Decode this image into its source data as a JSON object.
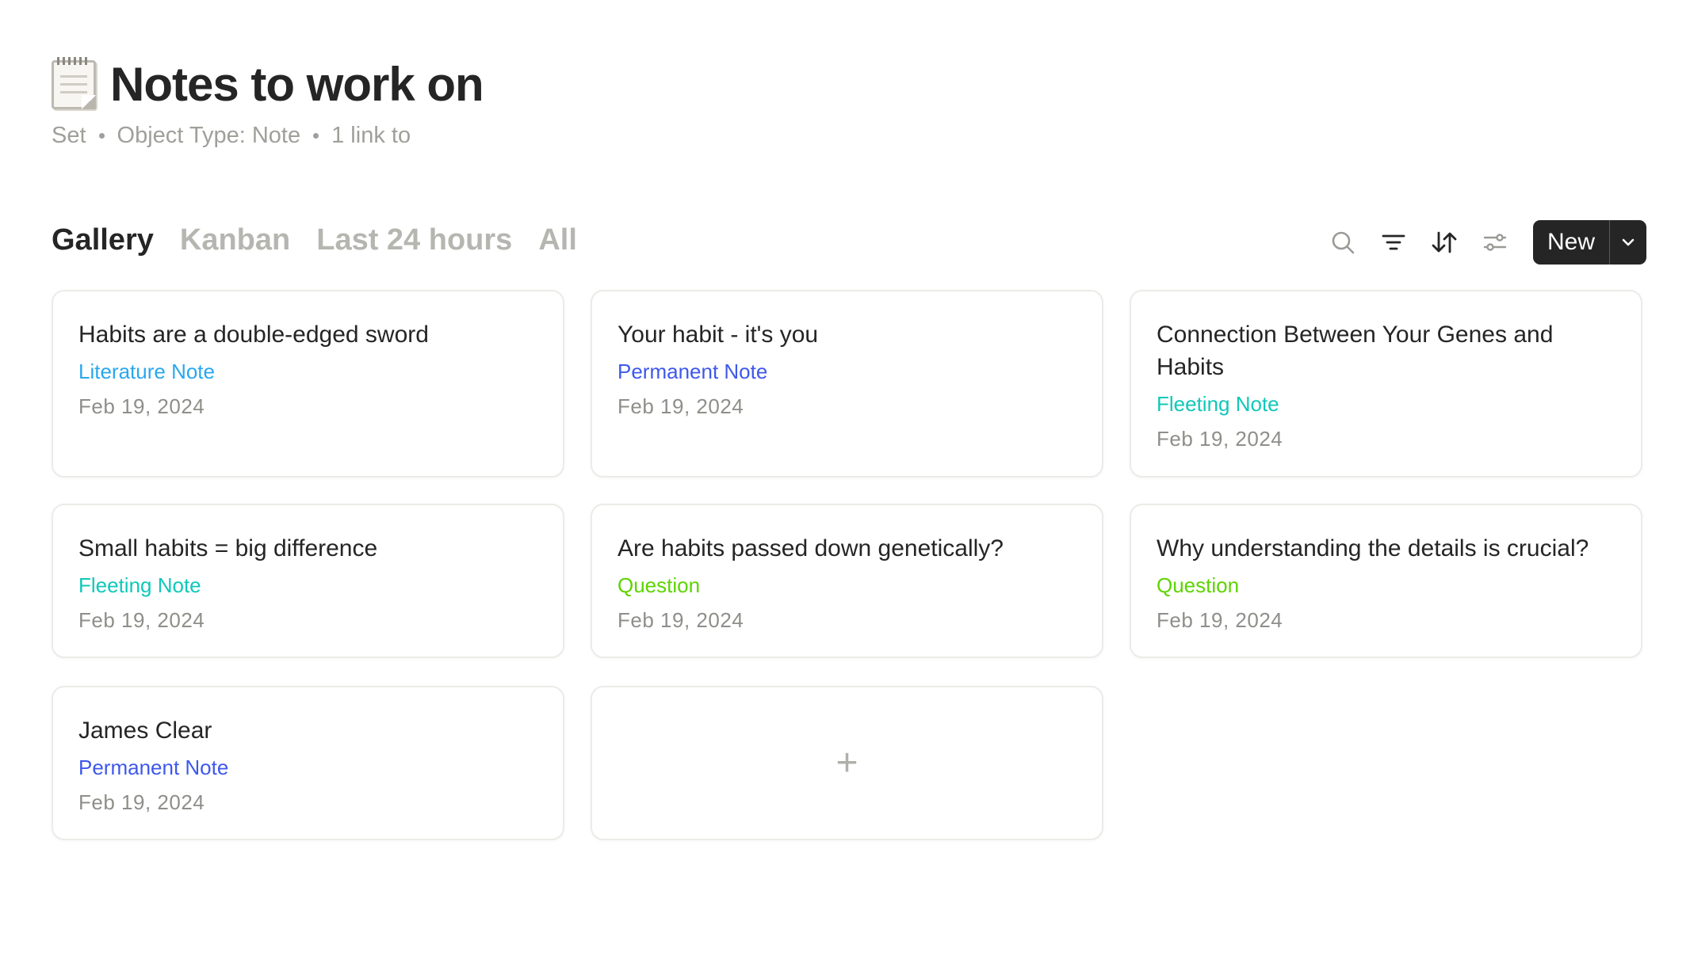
{
  "page": {
    "title": "Notes to work on",
    "meta": [
      "Set",
      "Object Type: Note",
      "1 link to"
    ]
  },
  "icons": {
    "title": "spiral-notepad-icon",
    "search": "search-icon",
    "filter": "filter-icon",
    "sort": "sort-icon",
    "settings": "view-settings-icon",
    "dropdown": "chevron-down-icon",
    "add": "plus-icon"
  },
  "views": [
    "Gallery",
    "Kanban",
    "Last 24 hours",
    "All"
  ],
  "toolbar": {
    "new_label": "New"
  },
  "type_colors": {
    "Literature Note": "#2aa7ee",
    "Permanent Note": "#3e58eb",
    "Fleeting Note": "#0fc8ba",
    "Question": "#5dd400"
  },
  "cards": [
    {
      "title": "Habits are a double-edged sword",
      "type": "Literature Note",
      "date": "Feb 19, 2024"
    },
    {
      "title": "Your habit - it's you",
      "type": "Permanent Note",
      "date": "Feb 19, 2024"
    },
    {
      "title": "Connection Between Your Genes and Habits",
      "type": "Fleeting Note",
      "date": "Feb 19, 2024"
    },
    {
      "title": "Small habits = big difference",
      "type": "Fleeting Note",
      "date": "Feb 19, 2024"
    },
    {
      "title": "Are habits passed down genetically?",
      "type": "Question",
      "date": "Feb 19, 2024"
    },
    {
      "title": "Why understanding the details is crucial?",
      "type": "Question",
      "date": "Feb 19, 2024"
    },
    {
      "title": "James Clear",
      "type": "Permanent Note",
      "date": "Feb 19, 2024"
    }
  ],
  "add_card": {
    "label": "+"
  }
}
